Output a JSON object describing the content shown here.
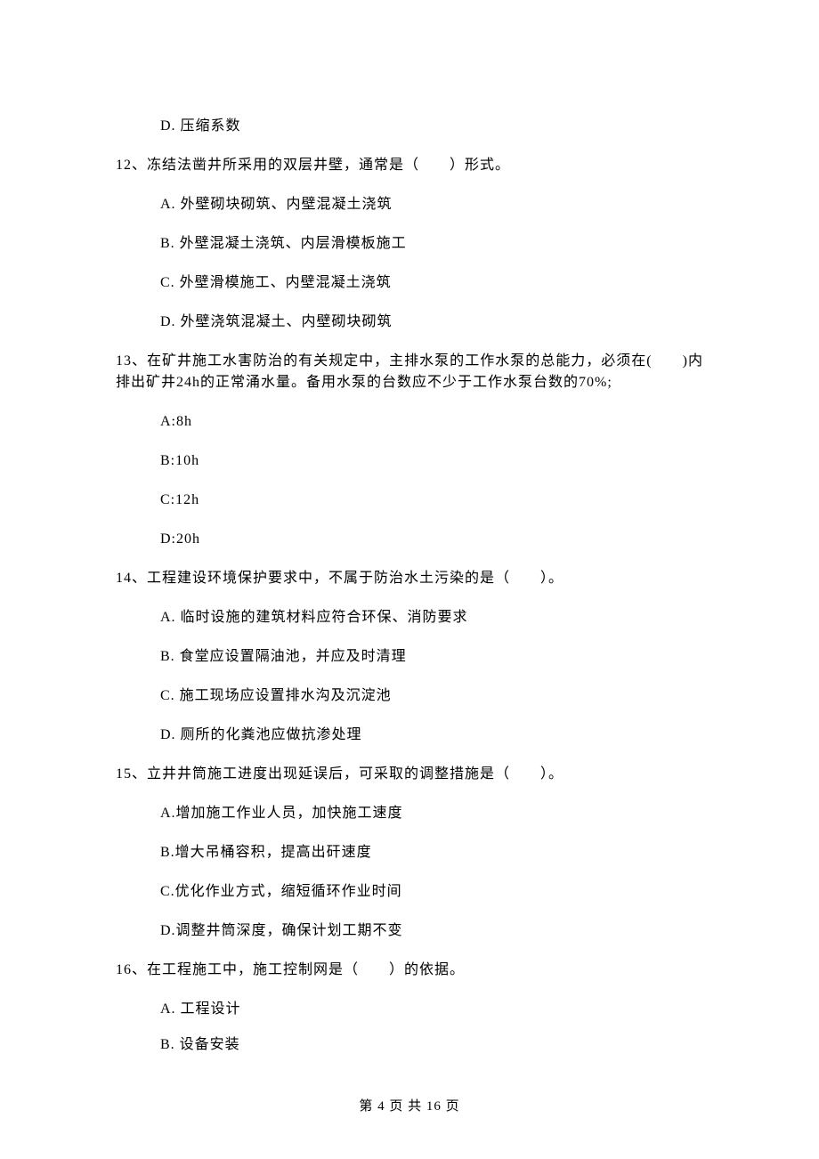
{
  "q11": {
    "D": "D. 压缩系数"
  },
  "q12": {
    "stem": "12、冻结法凿井所采用的双层井壁，通常是（　　）形式。",
    "A": "A. 外壁砌块砌筑、内壁混凝土浇筑",
    "B": "B. 外壁混凝土浇筑、内层滑模板施工",
    "C": "C. 外壁滑模施工、内壁混凝土浇筑",
    "D": "D. 外壁浇筑混凝土、内壁砌块砌筑"
  },
  "q13": {
    "stem": "13、在矿井施工水害防治的有关规定中，主排水泵的工作水泵的总能力，必须在(　　)内排出矿井24h的正常涌水量。备用水泵的台数应不少于工作水泵台数的70%;",
    "A": "A:8h",
    "B": "B:10h",
    "C": "C:12h",
    "D": "D:20h"
  },
  "q14": {
    "stem": "14、工程建设环境保护要求中，不属于防治水土污染的是（　　）。",
    "A": "A. 临时设施的建筑材料应符合环保、消防要求",
    "B": "B. 食堂应设置隔油池，并应及时清理",
    "C": "C. 施工现场应设置排水沟及沉淀池",
    "D": "D. 厕所的化粪池应做抗渗处理"
  },
  "q15": {
    "stem": "15、立井井筒施工进度出现延误后，可采取的调整措施是（　　）。",
    "A": "A.增加施工作业人员，加快施工速度",
    "B": "B.增大吊桶容积，提高出矸速度",
    "C": "C.优化作业方式，缩短循环作业时间",
    "D": "D.调整井筒深度，确保计划工期不变"
  },
  "q16": {
    "stem": "16、在工程施工中，施工控制网是（　　）的依据。",
    "A": "A. 工程设计",
    "B": "B. 设备安装"
  },
  "footer": "第 4 页 共 16 页"
}
